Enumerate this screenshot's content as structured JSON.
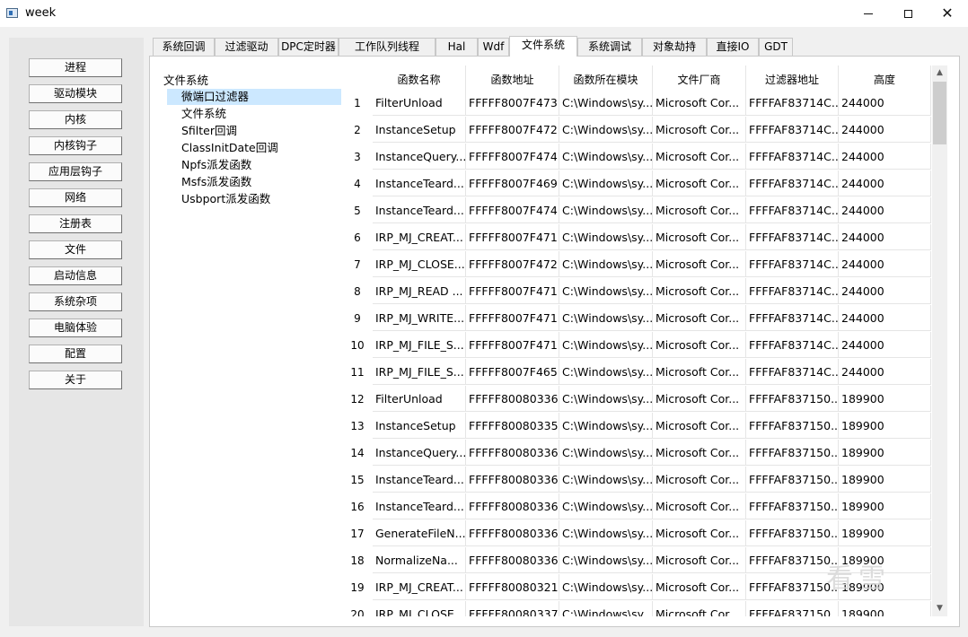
{
  "window": {
    "title": "week",
    "controls": {
      "minimize": "—",
      "maximize": "☐",
      "close": "✕"
    }
  },
  "sidebar": [
    "进程",
    "驱动模块",
    "内核",
    "内核钩子",
    "应用层钩子",
    "网络",
    "注册表",
    "文件",
    "启动信息",
    "系统杂项",
    "电脑体验",
    "配置",
    "关于"
  ],
  "tabs": [
    "系统回调",
    "过滤驱动",
    "DPC定时器",
    "工作队列线程",
    "Hal",
    "Wdf",
    "文件系统",
    "系统调试",
    "对象劫持",
    "直接IO",
    "GDT"
  ],
  "active_tab": "文件系统",
  "tree": {
    "root": "文件系统",
    "children": [
      "微端口过滤器",
      "文件系统",
      "Sfilter回调",
      "ClassInitDate回调",
      "Npfs派发函数",
      "Msfs派发函数",
      "Usbport派发函数"
    ],
    "selected": "微端口过滤器"
  },
  "table": {
    "columns": [
      "函数名称",
      "函数地址",
      "函数所在模块",
      "文件厂商",
      "过滤器地址",
      "高度"
    ],
    "rows": [
      {
        "n": "1",
        "c": [
          "FilterUnload",
          "FFFFF8007F473...",
          "C:\\Windows\\sy...",
          "Microsoft Cor...",
          "FFFFAF83714C...",
          "244000"
        ]
      },
      {
        "n": "2",
        "c": [
          "InstanceSetup",
          "FFFFF8007F472...",
          "C:\\Windows\\sy...",
          "Microsoft Cor...",
          "FFFFAF83714C...",
          "244000"
        ]
      },
      {
        "n": "3",
        "c": [
          "InstanceQuery...",
          "FFFFF8007F474...",
          "C:\\Windows\\sy...",
          "Microsoft Cor...",
          "FFFFAF83714C...",
          "244000"
        ]
      },
      {
        "n": "4",
        "c": [
          "InstanceTeard...",
          "FFFFF8007F469...",
          "C:\\Windows\\sy...",
          "Microsoft Cor...",
          "FFFFAF83714C...",
          "244000"
        ]
      },
      {
        "n": "5",
        "c": [
          "InstanceTeard...",
          "FFFFF8007F474...",
          "C:\\Windows\\sy...",
          "Microsoft Cor...",
          "FFFFAF83714C...",
          "244000"
        ]
      },
      {
        "n": "6",
        "c": [
          "IRP_MJ_CREAT...",
          "FFFFF8007F471...",
          "C:\\Windows\\sy...",
          "Microsoft Cor...",
          "FFFFAF83714C...",
          "244000"
        ]
      },
      {
        "n": "7",
        "c": [
          "IRP_MJ_CLOSE...",
          "FFFFF8007F472...",
          "C:\\Windows\\sy...",
          "Microsoft Cor...",
          "FFFFAF83714C...",
          "244000"
        ]
      },
      {
        "n": "8",
        "c": [
          "IRP_MJ_READ ...",
          "FFFFF8007F471...",
          "C:\\Windows\\sy...",
          "Microsoft Cor...",
          "FFFFAF83714C...",
          "244000"
        ]
      },
      {
        "n": "9",
        "c": [
          "IRP_MJ_WRITE...",
          "FFFFF8007F471...",
          "C:\\Windows\\sy...",
          "Microsoft Cor...",
          "FFFFAF83714C...",
          "244000"
        ]
      },
      {
        "n": "10",
        "c": [
          "IRP_MJ_FILE_S...",
          "FFFFF8007F471...",
          "C:\\Windows\\sy...",
          "Microsoft Cor...",
          "FFFFAF83714C...",
          "244000"
        ]
      },
      {
        "n": "11",
        "c": [
          "IRP_MJ_FILE_S...",
          "FFFFF8007F465...",
          "C:\\Windows\\sy...",
          "Microsoft Cor...",
          "FFFFAF83714C...",
          "244000"
        ]
      },
      {
        "n": "12",
        "c": [
          "FilterUnload",
          "FFFFF80080336...",
          "C:\\Windows\\sy...",
          "Microsoft Cor...",
          "FFFFAF837150...",
          "189900"
        ]
      },
      {
        "n": "13",
        "c": [
          "InstanceSetup",
          "FFFFF80080335...",
          "C:\\Windows\\sy...",
          "Microsoft Cor...",
          "FFFFAF837150...",
          "189900"
        ]
      },
      {
        "n": "14",
        "c": [
          "InstanceQuery...",
          "FFFFF80080336...",
          "C:\\Windows\\sy...",
          "Microsoft Cor...",
          "FFFFAF837150...",
          "189900"
        ]
      },
      {
        "n": "15",
        "c": [
          "InstanceTeard...",
          "FFFFF80080336...",
          "C:\\Windows\\sy...",
          "Microsoft Cor...",
          "FFFFAF837150...",
          "189900"
        ]
      },
      {
        "n": "16",
        "c": [
          "InstanceTeard...",
          "FFFFF80080336...",
          "C:\\Windows\\sy...",
          "Microsoft Cor...",
          "FFFFAF837150...",
          "189900"
        ]
      },
      {
        "n": "17",
        "c": [
          "GenerateFileN...",
          "FFFFF80080336...",
          "C:\\Windows\\sy...",
          "Microsoft Cor...",
          "FFFFAF837150...",
          "189900"
        ]
      },
      {
        "n": "18",
        "c": [
          "NormalizeNa...",
          "FFFFF80080336...",
          "C:\\Windows\\sy...",
          "Microsoft Cor...",
          "FFFFAF837150...",
          "189900"
        ]
      },
      {
        "n": "19",
        "c": [
          "IRP_MJ_CREAT...",
          "FFFFF80080321...",
          "C:\\Windows\\sy...",
          "Microsoft Cor...",
          "FFFFAF837150...",
          "189900"
        ]
      },
      {
        "n": "20",
        "c": [
          "IRP_MJ_CLOSE...",
          "FFFFF80080337...",
          "C:\\Windows\\sy...",
          "Microsoft Cor...",
          "FFFFAF837150...",
          "189900"
        ]
      }
    ]
  },
  "scrollbar": {
    "up": "▲",
    "down": "▼"
  },
  "watermark": "看雪"
}
